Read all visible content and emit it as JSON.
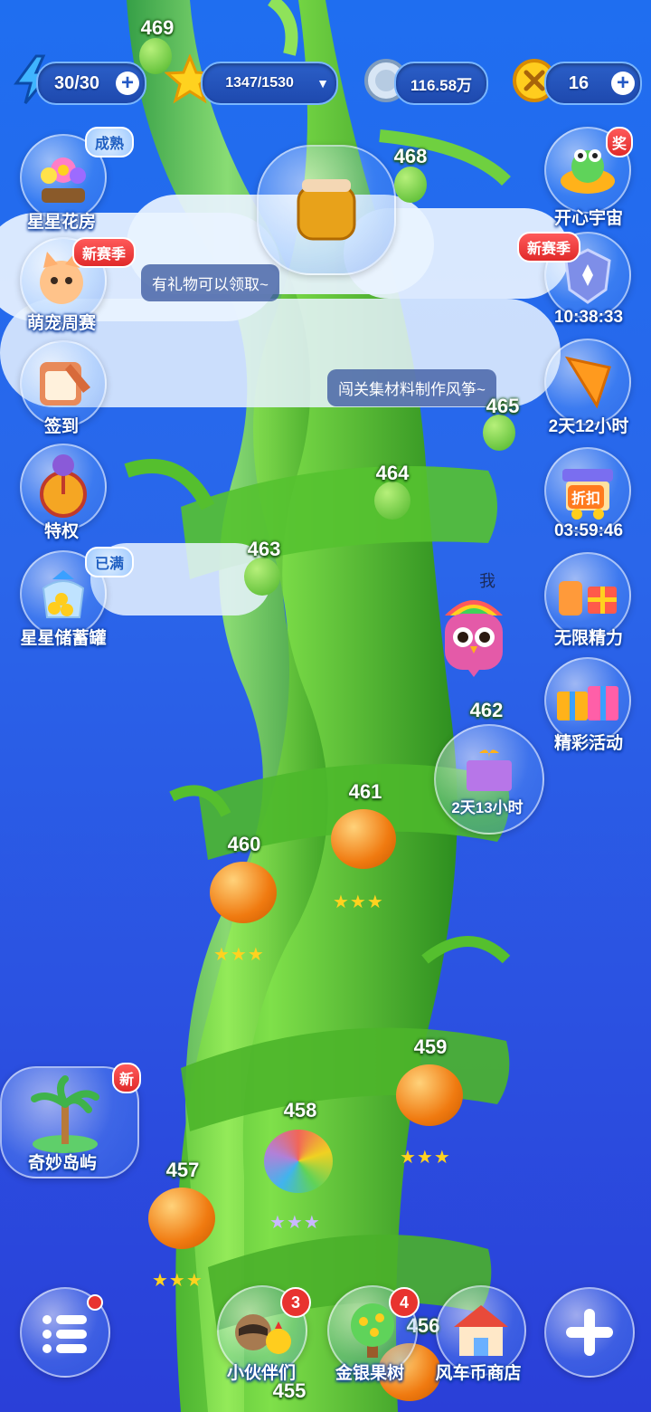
{
  "resources": {
    "energy": "30/30",
    "stars": "1347/1530",
    "coins": "116.58万",
    "windmill": "16"
  },
  "levels": {
    "l469": "469",
    "l468": "468",
    "l465": "465",
    "l464": "464",
    "l463": "463",
    "l462": "462",
    "l461": "461",
    "l460": "460",
    "l459": "459",
    "l458": "458",
    "l457": "457",
    "l456": "456",
    "l455": "455"
  },
  "left_menu": {
    "flower_house": "星星花房",
    "flower_house_tag": "成熟",
    "pet_weekly": "萌宠周赛",
    "pet_weekly_tag": "新赛季",
    "checkin": "签到",
    "privilege": "特权",
    "piggy_bank": "星星储蓄罐",
    "piggy_bank_tag": "已满",
    "island": "奇妙岛屿",
    "island_tag": "新"
  },
  "right_menu": {
    "happy_universe": "开心宇宙",
    "happy_universe_tag": "奖",
    "season_tag": "新赛季",
    "season_timer": "10:38:33",
    "kite_timer": "2天12小时",
    "discount_sign": "折扣",
    "discount_timer": "03:59:46",
    "unlimited_energy": "无限精力",
    "events": "精彩活动"
  },
  "tips": {
    "gift_tip": "有礼物可以领取~",
    "kite_tip": "闯关集材料制作风筝~"
  },
  "player": {
    "me_label": "我",
    "gift_timer": "2天13小时"
  },
  "bottom_bar": {
    "partners": "小伙伴们",
    "partners_badge": "3",
    "money_tree": "金银果树",
    "money_tree_badge": "4",
    "shop": "风车币商店"
  },
  "colors": {
    "sky": "#2a66ea",
    "stalk": "#5fcf3a",
    "badge_red": "#e8332f",
    "star_gold": "#ffd21f",
    "text_outline": "#0b3a9a"
  }
}
